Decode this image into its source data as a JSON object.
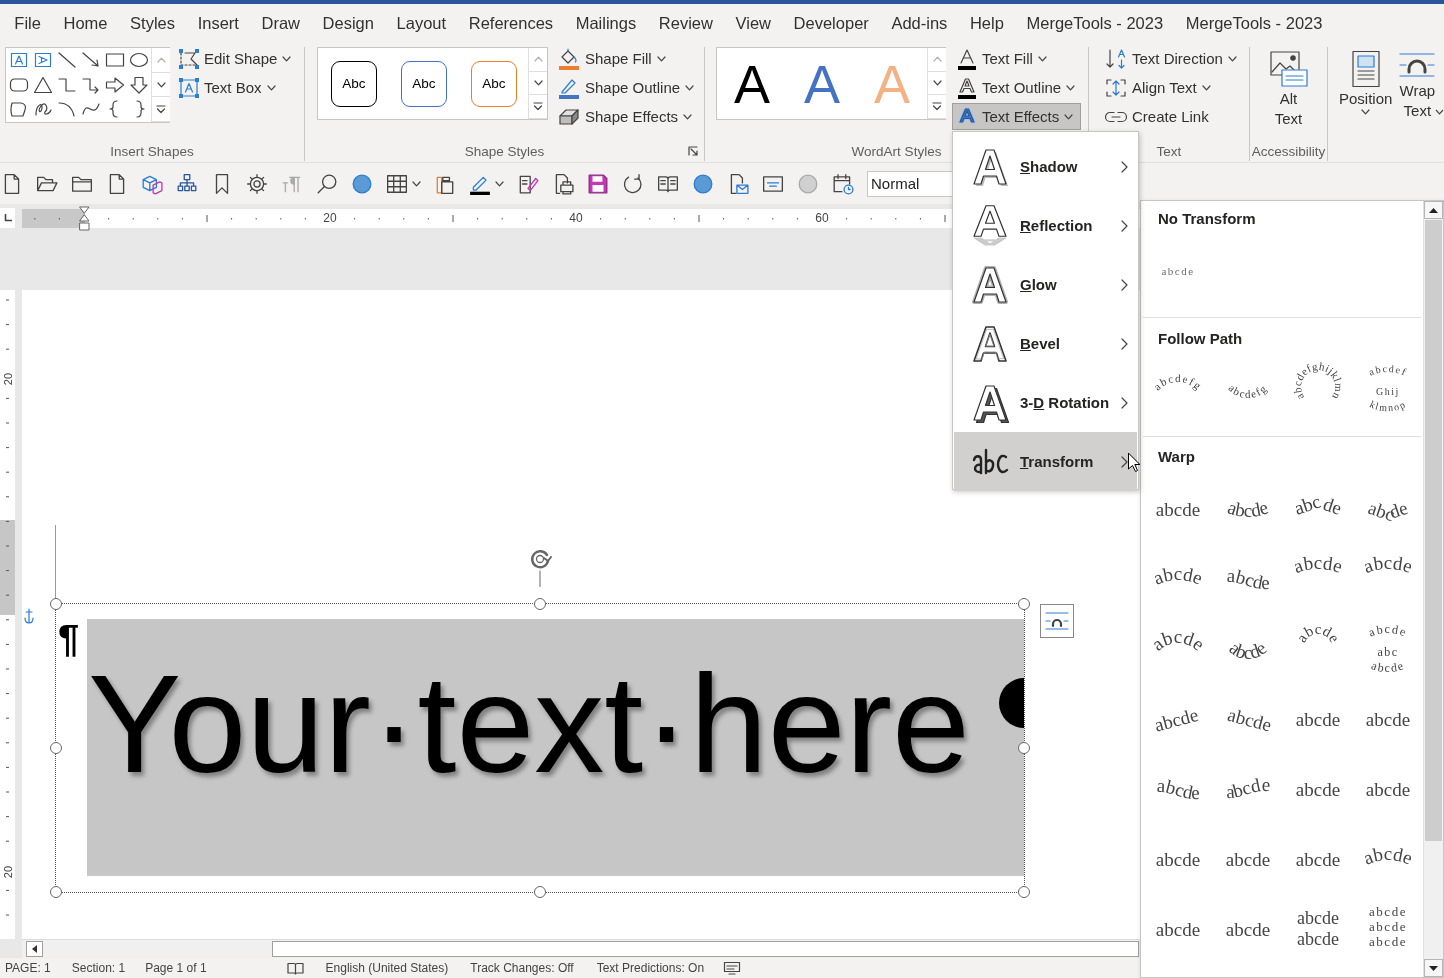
{
  "tabs": [
    {
      "label": "File"
    },
    {
      "label": "Home"
    },
    {
      "label": "Styles"
    },
    {
      "label": "Insert"
    },
    {
      "label": "Draw"
    },
    {
      "label": "Design"
    },
    {
      "label": "Layout"
    },
    {
      "label": "References"
    },
    {
      "label": "Mailings"
    },
    {
      "label": "Review"
    },
    {
      "label": "View"
    },
    {
      "label": "Developer"
    },
    {
      "label": "Add-ins"
    },
    {
      "label": "Help"
    },
    {
      "label": "MergeTools - 2023"
    },
    {
      "label": "MergeTools - 2023"
    }
  ],
  "ribbon": {
    "groups": [
      {
        "kind": "insert_shapes",
        "label": "Insert Shapes",
        "buttons": [
          {
            "label": "Edit Shape",
            "dropdown": true
          },
          {
            "label": "Text Box",
            "dropdown": true
          }
        ]
      },
      {
        "kind": "shape_styles",
        "label": "Shape Styles",
        "presets": [
          {
            "label": "Abc",
            "color": "#000000"
          },
          {
            "label": "Abc",
            "color": "#4472c4"
          },
          {
            "label": "Abc",
            "color": "#ed7d31"
          }
        ],
        "buttons": [
          {
            "label": "Shape Fill",
            "dropdown": true
          },
          {
            "label": "Shape Outline",
            "dropdown": true
          },
          {
            "label": "Shape Effects",
            "dropdown": true
          }
        ]
      },
      {
        "kind": "wordart_styles",
        "label": "WordArt Styles",
        "presets": [
          {
            "label": "A",
            "color": "#000000"
          },
          {
            "label": "A",
            "color": "#4472c4"
          },
          {
            "label": "A",
            "color": "#f4b183"
          }
        ],
        "buttons": [
          {
            "label": "Text Fill",
            "dropdown": true,
            "pressed": false
          },
          {
            "label": "Text Outline",
            "dropdown": true,
            "pressed": false
          },
          {
            "label": "Text Effects",
            "dropdown": true,
            "pressed": true
          }
        ]
      },
      {
        "kind": "text",
        "label": "Text",
        "buttons": [
          {
            "label": "Text Direction",
            "dropdown": true
          },
          {
            "label": "Align Text",
            "dropdown": true
          },
          {
            "label": "Create Link",
            "dropdown": false
          }
        ]
      },
      {
        "kind": "accessibility",
        "label": "Accessibility",
        "buttons": [
          {
            "label": "Alt Text",
            "dropdown": false
          }
        ]
      },
      {
        "kind": "arrange",
        "buttons": [
          {
            "label": "Position",
            "dropdown": true
          },
          {
            "label": "Wrap Text",
            "dropdown": true
          }
        ]
      }
    ]
  },
  "quick_access": {
    "style_box": {
      "value": "Normal"
    }
  },
  "ruler": {
    "labels": [
      "20",
      "40",
      "60"
    ]
  },
  "vertical_ruler": {
    "labels": [
      "20",
      "20"
    ]
  },
  "document": {
    "paragraph_mark": "¶",
    "text": "Your·text·here"
  },
  "status_bar": {
    "items": [
      "PAGE: 1",
      "Section: 1",
      "Page 1 of 1",
      "English (United States)",
      "Track Changes: Off",
      "Text Predictions: On"
    ]
  },
  "text_effects_menu": {
    "items": [
      {
        "key": "S",
        "after": "hadow",
        "selected": false
      },
      {
        "key": "R",
        "after": "eflection",
        "selected": false
      },
      {
        "key": "G",
        "after": "low",
        "selected": false
      },
      {
        "key": "B",
        "after": "evel",
        "selected": false
      },
      {
        "before": "3-",
        "key": "D",
        "after": " Rotation",
        "selected": false
      },
      {
        "key": "T",
        "after": "ransform",
        "selected": true
      }
    ]
  },
  "transform_gallery": {
    "sections": [
      {
        "title": "No Transform",
        "kind": "none",
        "options": [
          {
            "kind": "small",
            "lines": [
              "abcde"
            ]
          }
        ]
      },
      {
        "title": "Follow Path",
        "kind": "follow_path",
        "options": [
          {
            "kind": "big-arch-up",
            "lines": [
              "abcdefg"
            ]
          },
          {
            "kind": "big-arch-down",
            "lines": [
              "abcdefg"
            ]
          },
          {
            "kind": "circle",
            "lines": [
              "abcdefghijklmn"
            ]
          },
          {
            "kind": "button",
            "lines": [
              "abcdef",
              "Ghij",
              "klmnop"
            ]
          }
        ]
      },
      {
        "title": "Warp",
        "kind": "warp",
        "options": [
          {
            "kind": "straight",
            "lines": [
              "abcde"
            ]
          },
          {
            "kind": "arch-down",
            "lines": [
              "abcde"
            ]
          },
          {
            "kind": "chevron-up",
            "lines": [
              "abcde"
            ]
          },
          {
            "kind": "chevron-down",
            "lines": [
              "abcde"
            ]
          },
          {
            "kind": "arch-up",
            "lines": [
              "abcde"
            ]
          },
          {
            "kind": "wave",
            "lines": [
              "abcde"
            ]
          },
          {
            "kind": "ring",
            "lines": [
              "abcde"
            ]
          },
          {
            "kind": "ring",
            "lines": [
              "abcde"
            ]
          },
          {
            "kind": "big-arch-up",
            "lines": [
              "abcde"
            ]
          },
          {
            "kind": "big-arch-down",
            "lines": [
              "abcde"
            ]
          },
          {
            "kind": "circle",
            "lines": [
              "abcde"
            ]
          },
          {
            "kind": "button",
            "lines": [
              "abcde",
              "abc",
              "abcde"
            ]
          },
          {
            "kind": "slant-up",
            "lines": [
              "abcde"
            ]
          },
          {
            "kind": "slant-down",
            "lines": [
              "abcde"
            ]
          },
          {
            "kind": "straight",
            "lines": [
              "abcde"
            ]
          },
          {
            "kind": "straight",
            "lines": [
              "abcde"
            ]
          },
          {
            "kind": "wave",
            "lines": [
              "abcde"
            ]
          },
          {
            "kind": "wave-inverse",
            "lines": [
              "abcde"
            ]
          },
          {
            "kind": "straight",
            "lines": [
              "abcde"
            ]
          },
          {
            "kind": "straight",
            "lines": [
              "abcde"
            ]
          },
          {
            "kind": "straight",
            "lines": [
              "abcde"
            ]
          },
          {
            "kind": "straight",
            "lines": [
              "abcde"
            ]
          },
          {
            "kind": "straight",
            "lines": [
              "abcde"
            ]
          },
          {
            "kind": "arch-up",
            "lines": [
              "abcde"
            ]
          },
          {
            "kind": "straight",
            "lines": [
              "abcde"
            ]
          },
          {
            "kind": "straight",
            "lines": [
              "abcde"
            ]
          },
          {
            "kind": "stacked",
            "lines": [
              "abcde",
              "abcde"
            ]
          },
          {
            "kind": "stacked",
            "lines": [
              "abcde",
              "abcde",
              "abcde"
            ]
          }
        ]
      }
    ]
  }
}
